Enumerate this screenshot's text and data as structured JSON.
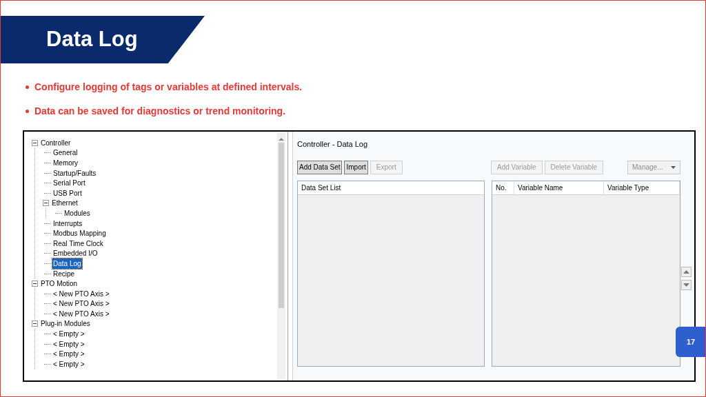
{
  "slide": {
    "title": "Data Log",
    "bullets": [
      "Configure logging of tags or variables at defined intervals.",
      "Data can be saved for diagnostics or trend monitoring."
    ],
    "page_number": "17"
  },
  "screenshot": {
    "tree": [
      {
        "label": "Controller",
        "expanded": true,
        "selected": false,
        "children": [
          {
            "label": "General",
            "selected": false
          },
          {
            "label": "Memory",
            "selected": false
          },
          {
            "label": "Startup/Faults",
            "selected": false
          },
          {
            "label": "Serial Port",
            "selected": false
          },
          {
            "label": "USB Port",
            "selected": false
          },
          {
            "label": "Ethernet",
            "expanded": true,
            "selected": false,
            "children": [
              {
                "label": "Modules",
                "selected": false
              }
            ]
          },
          {
            "label": "Interrupts",
            "selected": false
          },
          {
            "label": "Modbus Mapping",
            "selected": false
          },
          {
            "label": "Real Time Clock",
            "selected": false
          },
          {
            "label": "Embedded I/O",
            "selected": false
          },
          {
            "label": "Data Log",
            "selected": true
          },
          {
            "label": "Recipe",
            "selected": false
          }
        ]
      },
      {
        "label": "PTO Motion",
        "expanded": true,
        "selected": false,
        "children": [
          {
            "label": "< New PTO Axis >",
            "selected": false
          },
          {
            "label": "< New PTO Axis >",
            "selected": false
          },
          {
            "label": "< New PTO Axis >",
            "selected": false
          }
        ]
      },
      {
        "label": "Plug-in Modules",
        "expanded": true,
        "selected": false,
        "children": [
          {
            "label": "< Empty >",
            "selected": false
          },
          {
            "label": "< Empty >",
            "selected": false
          },
          {
            "label": "< Empty >",
            "selected": false
          },
          {
            "label": "< Empty >",
            "selected": false
          }
        ]
      }
    ],
    "panel_title": "Controller - Data Log",
    "left_buttons": [
      {
        "label": "Add Data Set",
        "disabled": false
      },
      {
        "label": "Import",
        "disabled": false
      },
      {
        "label": "Export",
        "disabled": true
      }
    ],
    "right_buttons": [
      {
        "label": "Add Variable",
        "disabled": true
      },
      {
        "label": "Delete Variable",
        "disabled": true
      }
    ],
    "manage_dropdown": {
      "label": "Manage...",
      "disabled": true
    },
    "data_set_list": {
      "columns": [
        "Data Set List"
      ]
    },
    "variables_table": {
      "columns": [
        "No.",
        "Variable Name",
        "Variable Type"
      ]
    }
  }
}
